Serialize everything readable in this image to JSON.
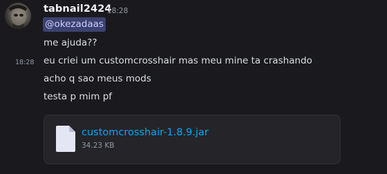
{
  "message": {
    "author": "tabnail2424",
    "timestamp": "18:28",
    "mention": "@okezadaas",
    "lines": [
      "me ajuda??",
      "eu criei um customcrosshair mas meu mine ta crashando",
      "acho q sao meus mods",
      "testa p mim pf"
    ],
    "hover_timestamp": "18:28",
    "attachment": {
      "filename": "customcrosshair-1.8.9.jar",
      "size": "34.23 KB",
      "icon": "file-icon"
    }
  },
  "colors": {
    "background": "#1a1a1e",
    "mention_bg": "#3c4270",
    "mention_text": "#c9cdfb",
    "link": "#00a8fc",
    "muted": "#949ba4",
    "attachment_bg": "#242429"
  }
}
